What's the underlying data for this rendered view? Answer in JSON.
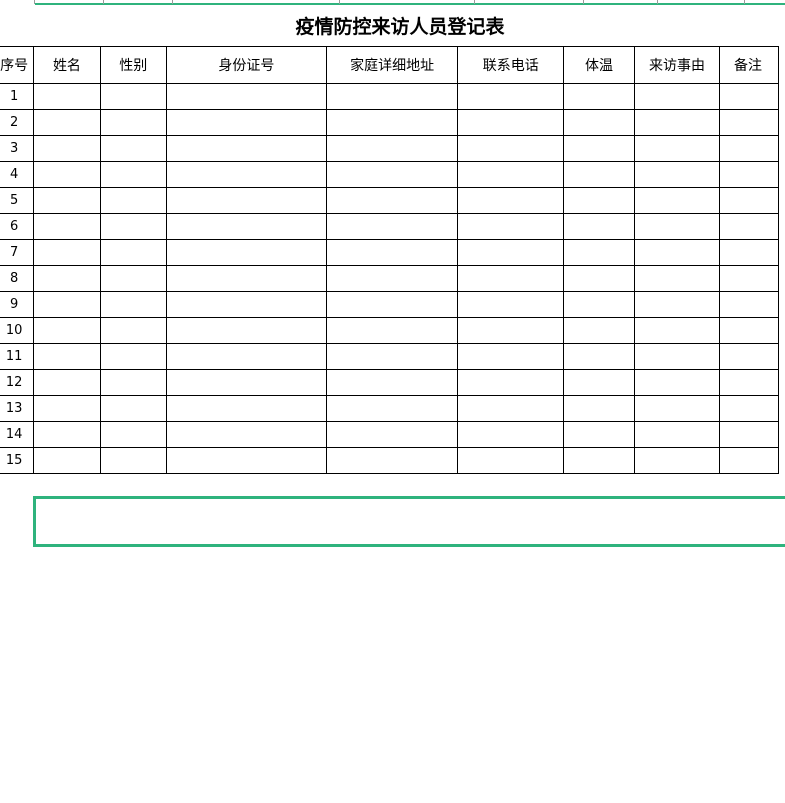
{
  "sheet": {
    "title": "疫情防控来访人员登记表",
    "headers": [
      "序号",
      "姓名",
      "性别",
      "身份证号",
      "家庭详细地址",
      "联系电话",
      "体温",
      "来访事由",
      "备注"
    ],
    "row_numbers": [
      "1",
      "2",
      "3",
      "4",
      "5",
      "6",
      "7",
      "8",
      "9",
      "10",
      "11",
      "12",
      "13",
      "14",
      "15"
    ]
  },
  "colors": {
    "selection_border": "#2fb37d",
    "grid_line": "#000000"
  }
}
